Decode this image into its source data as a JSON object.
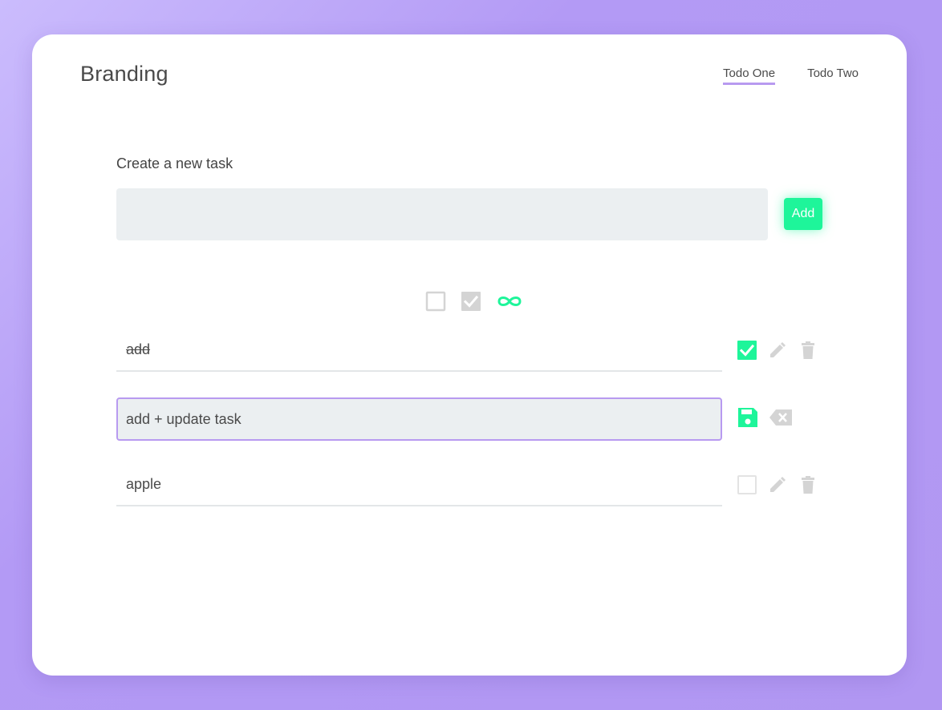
{
  "header": {
    "brand": "Branding",
    "nav": [
      {
        "label": "Todo One",
        "active": true
      },
      {
        "label": "Todo Two",
        "active": false
      }
    ]
  },
  "new_task": {
    "label": "Create a new task",
    "value": "",
    "placeholder": "",
    "add_label": "Add"
  },
  "filters": [
    {
      "icon": "checkbox-empty-icon"
    },
    {
      "icon": "checkbox-checked-icon"
    },
    {
      "icon": "infinity-icon"
    }
  ],
  "tasks": [
    {
      "text": "add",
      "completed": true,
      "editing": false
    },
    {
      "text": "add + update task",
      "completed": false,
      "editing": true
    },
    {
      "text": "apple",
      "completed": false,
      "editing": false
    }
  ],
  "colors": {
    "accent_green": "#1ef59a",
    "accent_purple": "#b89af0",
    "icon_gray": "#d4d4d4",
    "input_bg": "#ebeff1"
  }
}
